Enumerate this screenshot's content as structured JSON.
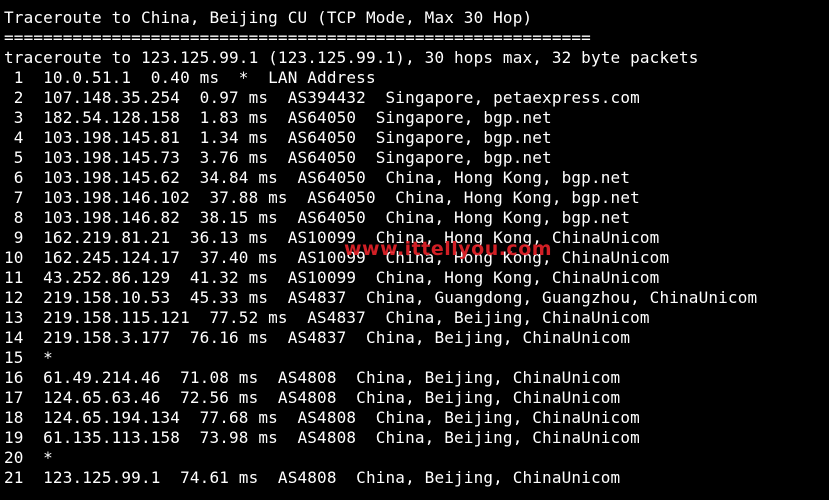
{
  "terminal": {
    "header": "Traceroute to China, Beijing CU (TCP Mode, Max 30 Hop)",
    "separator": "============================================================",
    "command": "traceroute to 123.125.99.1 (123.125.99.1), 30 hops max, 32 byte packets",
    "hops": [
      " 1  10.0.51.1  0.40 ms  *  LAN Address",
      " 2  107.148.35.254  0.97 ms  AS394432  Singapore, petaexpress.com",
      " 3  182.54.128.158  1.83 ms  AS64050  Singapore, bgp.net",
      " 4  103.198.145.81  1.34 ms  AS64050  Singapore, bgp.net",
      " 5  103.198.145.73  3.76 ms  AS64050  Singapore, bgp.net",
      " 6  103.198.145.62  34.84 ms  AS64050  China, Hong Kong, bgp.net",
      " 7  103.198.146.102  37.88 ms  AS64050  China, Hong Kong, bgp.net",
      " 8  103.198.146.82  38.15 ms  AS64050  China, Hong Kong, bgp.net",
      " 9  162.219.81.21  36.13 ms  AS10099  China, Hong Kong, ChinaUnicom",
      "10  162.245.124.17  37.40 ms  AS10099  China, Hong Kong, ChinaUnicom",
      "11  43.252.86.129  41.32 ms  AS10099  China, Hong Kong, ChinaUnicom",
      "12  219.158.10.53  45.33 ms  AS4837  China, Guangdong, Guangzhou, ChinaUnicom",
      "13  219.158.115.121  77.52 ms  AS4837  China, Beijing, ChinaUnicom",
      "14  219.158.3.177  76.16 ms  AS4837  China, Beijing, ChinaUnicom",
      "15  *",
      "16  61.49.214.46  71.08 ms  AS4808  China, Beijing, ChinaUnicom",
      "17  124.65.63.46  72.56 ms  AS4808  China, Beijing, ChinaUnicom",
      "18  124.65.194.134  77.68 ms  AS4808  China, Beijing, ChinaUnicom",
      "19  61.135.113.158  73.98 ms  AS4808  China, Beijing, ChinaUnicom",
      "20  *",
      "21  123.125.99.1  74.61 ms  AS4808  China, Beijing, ChinaUnicom"
    ]
  },
  "watermark": {
    "text": "www.ittellyou.com",
    "color": "#e8232a"
  },
  "colors": {
    "background": "#000000",
    "foreground": "#ffffff"
  }
}
